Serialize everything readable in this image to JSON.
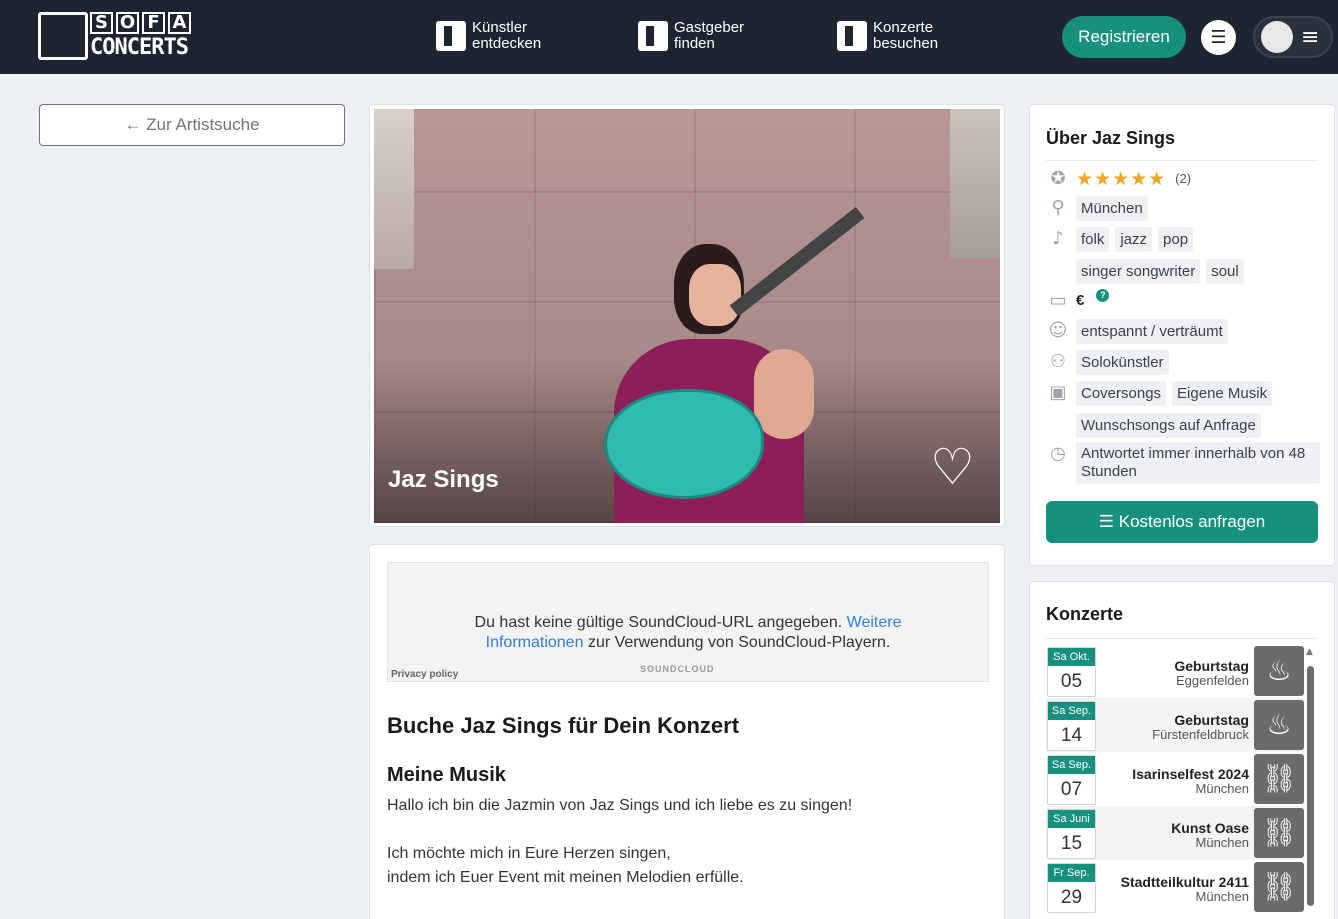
{
  "header": {
    "logo_top": [
      "S",
      "O",
      "F",
      "A"
    ],
    "logo_bottom": "CONCERTS",
    "nav": [
      {
        "line1": "Künstler",
        "line2": "entdecken"
      },
      {
        "line1": "Gastgeber",
        "line2": "finden"
      },
      {
        "line1": "Konzerte",
        "line2": "besuchen"
      }
    ],
    "register_label": "Registrieren"
  },
  "back_label": "← Zur Artistsuche",
  "hero": {
    "name": "Jaz Sings"
  },
  "soundcloud": {
    "msg_before": "Du hast keine gültige SoundCloud-URL angegeben.",
    "link": "Weitere Informationen",
    "msg_after": "zur Verwendung von SoundCloud-Playern.",
    "logo_text": "SOUNDCLOUD",
    "privacy": "Privacy policy"
  },
  "content": {
    "heading": "Buche Jaz Sings für Dein Konzert",
    "subheading": "Meine Musik",
    "p1": "Hallo ich bin die Jazmin von Jaz Sings und ich liebe es zu singen!",
    "p2": "Ich möchte mich in Eure Herzen singen,",
    "p3": "indem ich Euer Event mit meinen Melodien erfülle."
  },
  "about": {
    "title": "Über Jaz Sings",
    "rating": {
      "stars": 5,
      "max": 5,
      "count_label": "(2)"
    },
    "city": "München",
    "genres": [
      "folk",
      "jazz",
      "pop",
      "singer songwriter",
      "soul"
    ],
    "price": "€",
    "price_help": "?",
    "mood": "entspannt / verträumt",
    "formation": "Solokünstler",
    "repertoire": [
      "Coversongs",
      "Eigene Musik",
      "Wunschsongs auf Anfrage"
    ],
    "response": "Antwortet immer innerhalb von 48 Stunden",
    "cta_label": "Kostenlos anfragen"
  },
  "concerts": {
    "title": "Konzerte",
    "items": [
      {
        "month": "Sa Okt.",
        "day": "05",
        "title": "Geburtstag",
        "place": "Eggenfelden",
        "thumb": "cake-icon"
      },
      {
        "month": "Sa Sep.",
        "day": "14",
        "title": "Geburtstag",
        "place": "Fürstenfeldbruck",
        "thumb": "cake-icon"
      },
      {
        "month": "Sa Sep.",
        "day": "07",
        "title": "Isarinselfest 2024",
        "place": "München",
        "thumb": "link-icon"
      },
      {
        "month": "Sa Juni",
        "day": "15",
        "title": "Kunst Oase",
        "place": "München",
        "thumb": "link-icon"
      },
      {
        "month": "Fr Sep.",
        "day": "29",
        "title": "Stadtteilkultur 2411",
        "place": "München",
        "thumb": "link-icon"
      }
    ]
  }
}
